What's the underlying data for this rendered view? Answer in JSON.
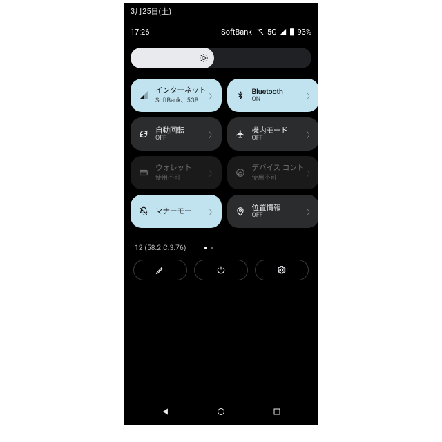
{
  "date": "3月25日(土)",
  "status": {
    "time": "17:26",
    "carrier": "SoftBank",
    "network": "5G",
    "battery": "93%"
  },
  "brightness": {
    "percent": 46
  },
  "tiles": [
    {
      "key": "internet",
      "title": "インターネット",
      "sub": "SoftBank、5GB",
      "state": "active",
      "icon": "signal",
      "expand": true
    },
    {
      "key": "bluetooth",
      "title": "Bluetooth",
      "sub": "ON",
      "state": "active",
      "icon": "bt",
      "expand": true
    },
    {
      "key": "rotate",
      "title": "自動回転",
      "sub": "OFF",
      "state": "inactive",
      "icon": "rotate",
      "expand": true
    },
    {
      "key": "airplane",
      "title": "機内モード",
      "sub": "OFF",
      "state": "inactive",
      "icon": "plane",
      "expand": true
    },
    {
      "key": "wallet",
      "title": "ウォレット",
      "sub": "使用不可",
      "state": "disabled",
      "icon": "card",
      "expand": true
    },
    {
      "key": "device",
      "title": "デバイス コント",
      "sub": "使用不可",
      "state": "disabled",
      "icon": "home",
      "expand": true
    },
    {
      "key": "dnd",
      "title": "マナーモー",
      "sub": "",
      "state": "active",
      "icon": "bell-off",
      "expand": true
    },
    {
      "key": "location",
      "title": "位置情報",
      "sub": "OFF",
      "state": "inactive",
      "icon": "pin",
      "expand": true
    }
  ],
  "build": "12 (58.2.C.3.76)",
  "footer": {
    "edit": "edit",
    "power": "power",
    "settings": "settings"
  }
}
